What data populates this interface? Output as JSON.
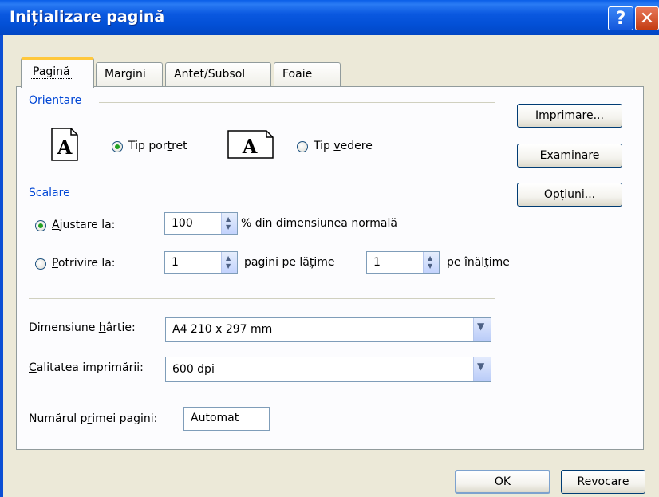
{
  "window": {
    "title": "Inițializare pagină"
  },
  "titlebar": {
    "help": "?",
    "close": "✕"
  },
  "tabs": [
    "Pagină",
    "Margini",
    "Antet/Subsol",
    "Foaie"
  ],
  "orientation": {
    "group": "Orientare",
    "icon_letter": "A",
    "portrait": "Tip portret",
    "landscape": "Tip vedere",
    "selected": "portrait"
  },
  "scaling": {
    "group": "Scalare",
    "adjust_label": "Ajustare la:",
    "adjust_value": "100",
    "adjust_suffix": "% din dimensiunea normală",
    "fit_label": "Potrivire la:",
    "fit_width_value": "1",
    "fit_width_suffix": "pagini pe lățime",
    "fit_height_value": "1",
    "fit_height_suffix": "pe înălțime",
    "selected": "adjust"
  },
  "paper": {
    "label": "Dimensiune hârtie:",
    "value": "A4 210 x 297 mm"
  },
  "quality": {
    "label": "Calitatea imprimării:",
    "value": "600 dpi"
  },
  "first_page": {
    "label": "Numărul primei pagini:",
    "value": "Automat"
  },
  "side_buttons": {
    "print": "Imprimare...",
    "preview": "Examinare",
    "options": "Opțiuni..."
  },
  "footer": {
    "ok": "OK",
    "cancel": "Revocare"
  },
  "colors": {
    "title_blue": "#0350d6",
    "group_title": "#0046d5",
    "radio_dot": "#21a121",
    "tab_highlight": "#ffc83c"
  }
}
